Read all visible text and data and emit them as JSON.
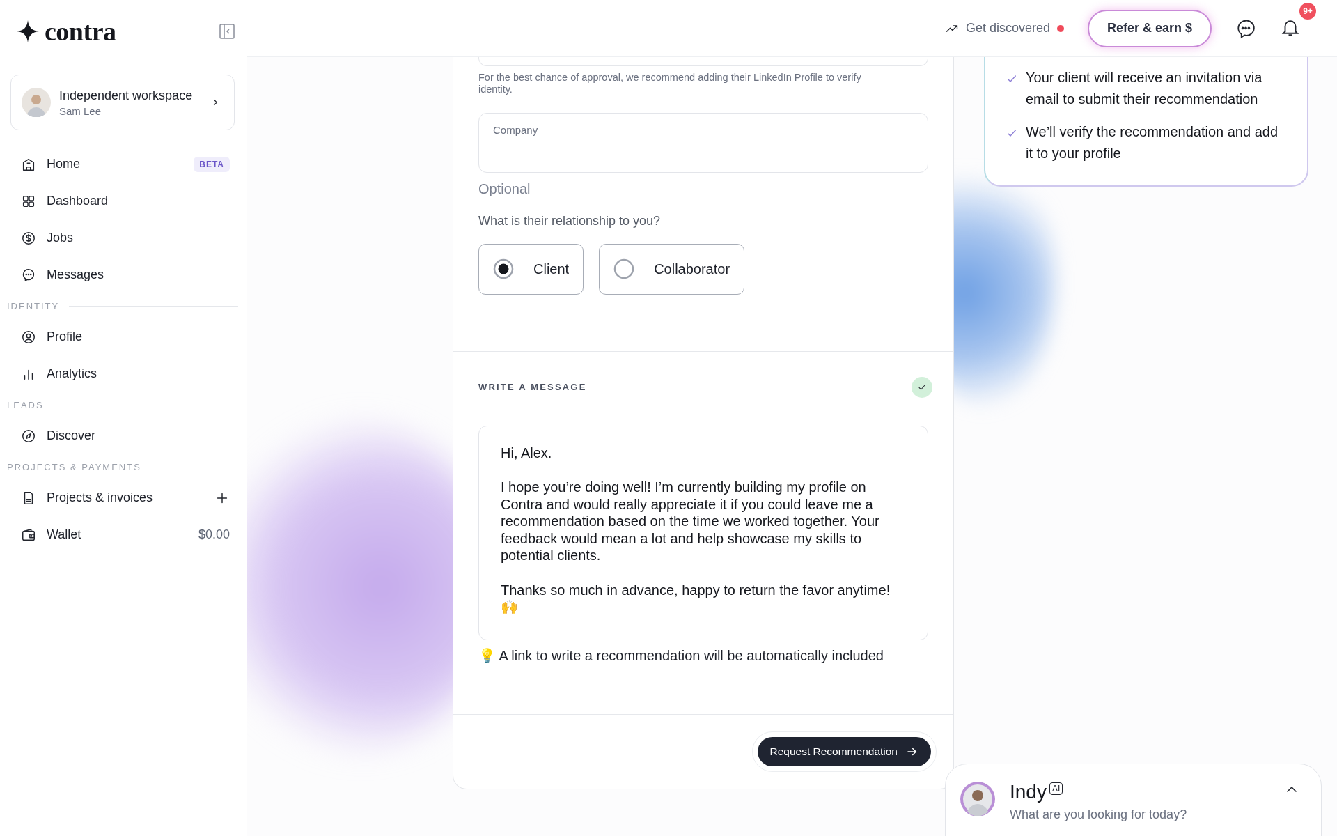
{
  "sidebar": {
    "logo": "contra",
    "workspace": {
      "title": "Independent workspace",
      "user": "Sam Lee"
    },
    "sections": [
      {
        "items": [
          {
            "label": "Home",
            "badge": "BETA"
          },
          {
            "label": "Dashboard"
          },
          {
            "label": "Jobs"
          },
          {
            "label": "Messages"
          }
        ]
      },
      {
        "heading": "IDENTITY",
        "items": [
          {
            "label": "Profile"
          },
          {
            "label": "Analytics"
          }
        ]
      },
      {
        "heading": "LEADS",
        "items": [
          {
            "label": "Discover"
          }
        ]
      },
      {
        "heading": "PROJECTS & PAYMENTS",
        "items": [
          {
            "label": "Projects & invoices",
            "add_button": true
          },
          {
            "label": "Wallet",
            "value": "$0.00"
          }
        ]
      }
    ]
  },
  "topbar": {
    "discover": "Get discovered",
    "discover_alert": true,
    "refer": "Refer & earn $",
    "notifications": "9+"
  },
  "info_card": {
    "points": [
      "Your client will receive an invitation via email to submit their recommendation",
      "We’ll verify the recommendation and add it to your profile"
    ]
  },
  "form": {
    "hint": "For the best chance of approval, we recommend adding their LinkedIn Profile to verify identity.",
    "company": {
      "label": "Company"
    },
    "optional": "Optional",
    "question": "What is their relationship to you?",
    "relationship": [
      {
        "label": "Client",
        "selected": true
      },
      {
        "label": "Collaborator",
        "selected": false
      }
    ],
    "message_section": {
      "heading": "WRITE A MESSAGE",
      "complete": true,
      "message": "Hi, Alex.\n\nI hope you’re doing well! I’m currently building my profile on Contra and would really appreciate it if you could leave me a recommendation based on the time we worked together. Your feedback would mean a lot and help showcase my skills to potential clients.\n\nThanks so much in advance, happy to return the favor anytime! 🙌"
    },
    "tip": "💡 A link to write a recommendation will be automatically included",
    "submit": "Request Recommendation"
  },
  "assistant": {
    "name": "Indy",
    "tag": "AI",
    "prompt": "What are you looking for today?"
  }
}
